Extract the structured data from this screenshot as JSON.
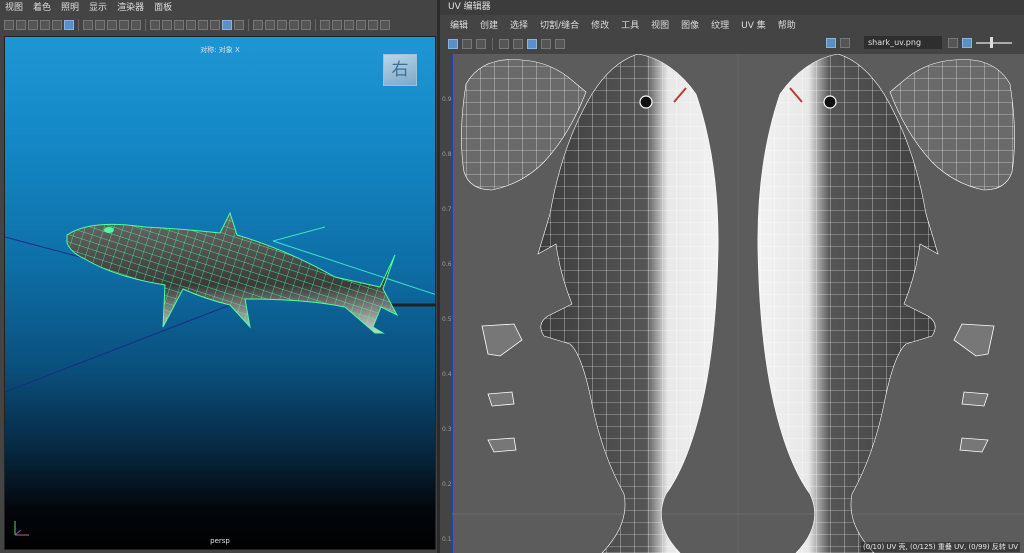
{
  "left_menu": [
    "视图",
    "着色",
    "照明",
    "显示",
    "渲染器",
    "面板"
  ],
  "viewport": {
    "hud_label": "对称: 对象 X",
    "camera": "persp",
    "viewcube_label": "右",
    "axis_label": "Y\n └ X"
  },
  "uv_editor": {
    "title": "UV 编辑器",
    "menu": [
      "编辑",
      "创建",
      "选择",
      "切割/缝合",
      "修改",
      "工具",
      "视图",
      "图像",
      "纹理",
      "UV 集",
      "帮助"
    ],
    "texture_name": "shark_uv.png",
    "ruler_ticks": [
      "0.9",
      "0.8",
      "0.7",
      "0.6",
      "0.5",
      "0.4",
      "0.3",
      "0.2",
      "0.1"
    ],
    "status": "(0/10) UV 壳, (0/125) 重叠 UV, (0/99) 反转 UV"
  },
  "colors": {
    "wireframe_selected": "#4dff9a",
    "uv_grid": "#ffffff",
    "seam": "#b83c3c"
  }
}
